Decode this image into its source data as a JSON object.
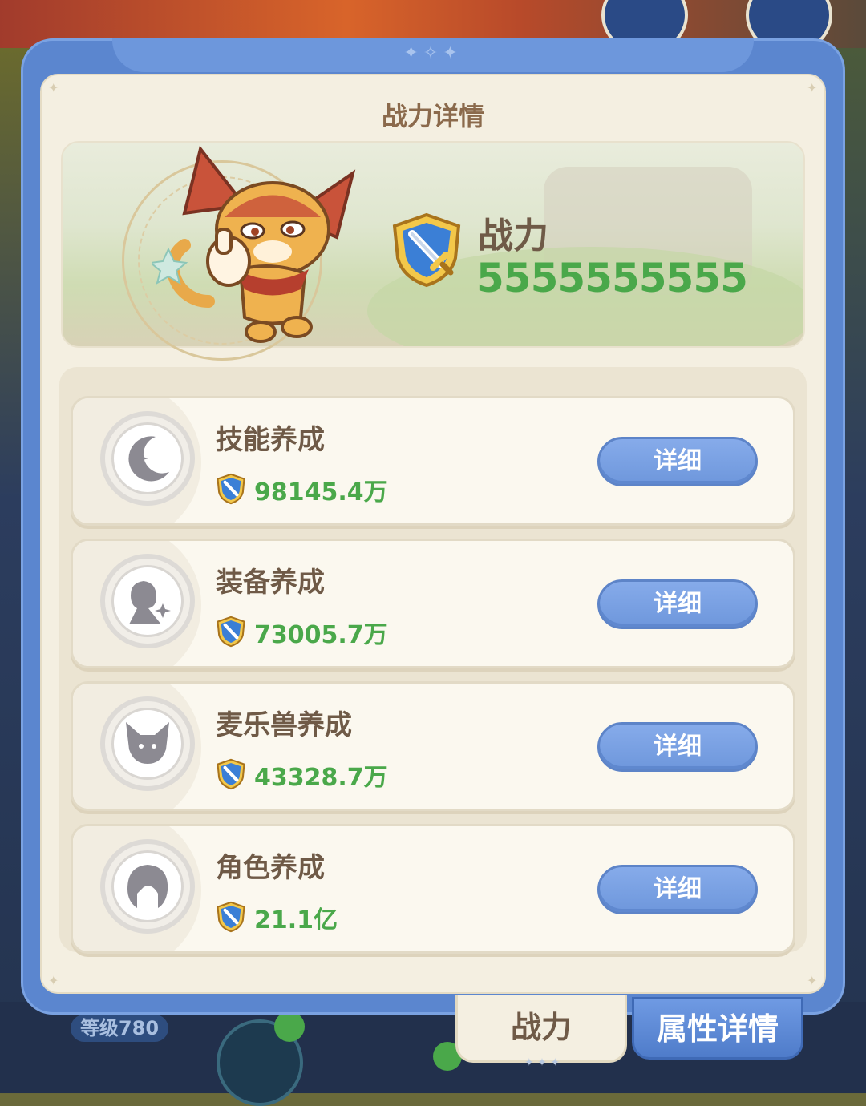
{
  "dialog": {
    "title": "战力详情"
  },
  "banner": {
    "power_label": "战力",
    "power_value": "5555555555"
  },
  "cards": [
    {
      "title": "技能养成",
      "value": "98145.4万",
      "button": "详细",
      "icon": "moon-icon"
    },
    {
      "title": "装备养成",
      "value": "73005.7万",
      "button": "详细",
      "icon": "figure-icon"
    },
    {
      "title": "麦乐兽养成",
      "value": "43328.7万",
      "button": "详细",
      "icon": "fox-icon"
    },
    {
      "title": "角色养成",
      "value": "21.1亿",
      "button": "详细",
      "icon": "hair-icon"
    }
  ],
  "tabs": {
    "active": "战力",
    "inactive": "属性详情"
  },
  "background": {
    "level_badge": "等级780"
  },
  "colors": {
    "frame_blue": "#5b86cf",
    "panel_cream": "#f4efe1",
    "value_green": "#4aa84a",
    "text_brown": "#6f5a47",
    "button_blue": "#7aa2e6"
  }
}
